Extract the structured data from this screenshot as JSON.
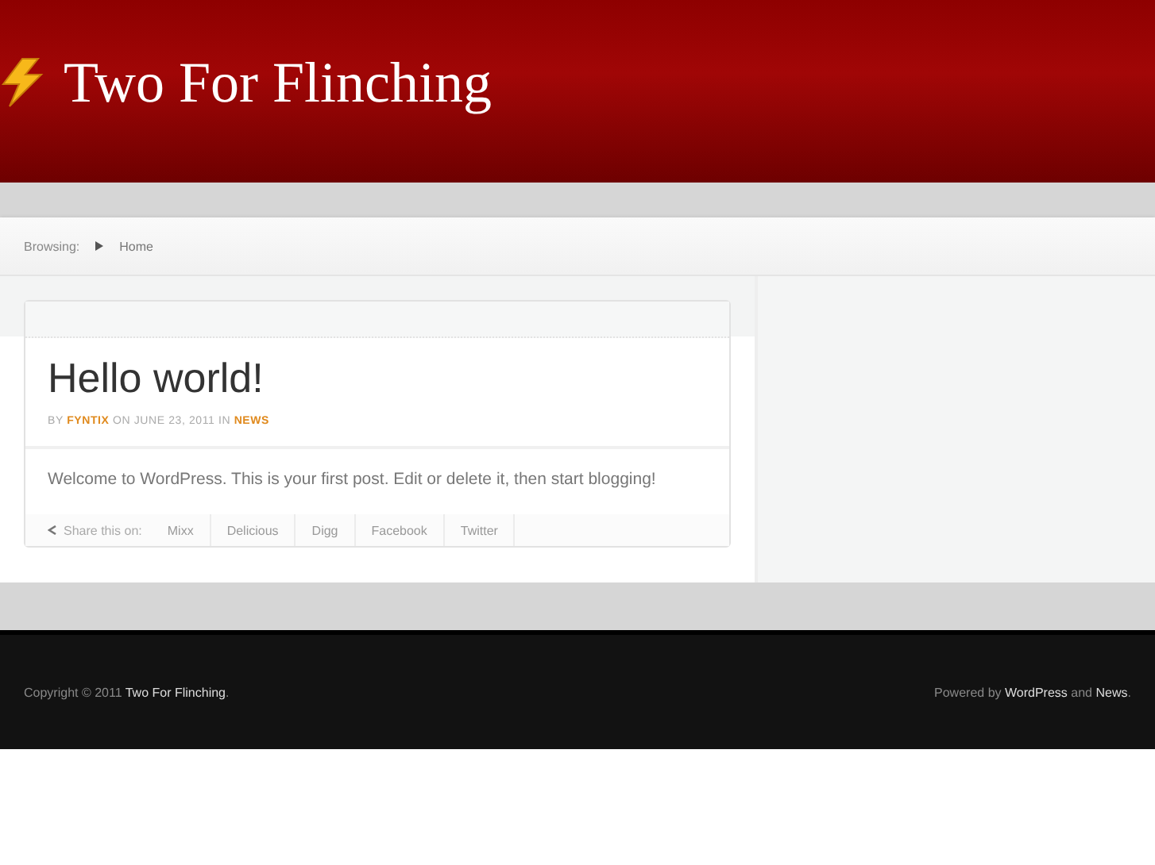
{
  "site_title": "Two For Flinching",
  "breadcrumb": {
    "label": "Browsing:",
    "items": [
      "Home"
    ]
  },
  "post": {
    "title": "Hello world!",
    "meta": {
      "by": "BY",
      "author": "FYNTIX",
      "on": "ON JUNE 23, 2011",
      "in": "IN",
      "category": "NEWS"
    },
    "body": "Welcome to WordPress. This is your first post. Edit or delete it, then start blogging!",
    "share": {
      "label": "Share this on:",
      "links": [
        "Mixx",
        "Delicious",
        "Digg",
        "Facebook",
        "Twitter"
      ]
    }
  },
  "footer": {
    "left": {
      "text": "Copyright © 2011",
      "link": "Two For Flinching",
      "end": "."
    },
    "right": {
      "text": "Powered by",
      "link1": "WordPress",
      "and": "and",
      "link2": "News",
      "end": "."
    }
  }
}
